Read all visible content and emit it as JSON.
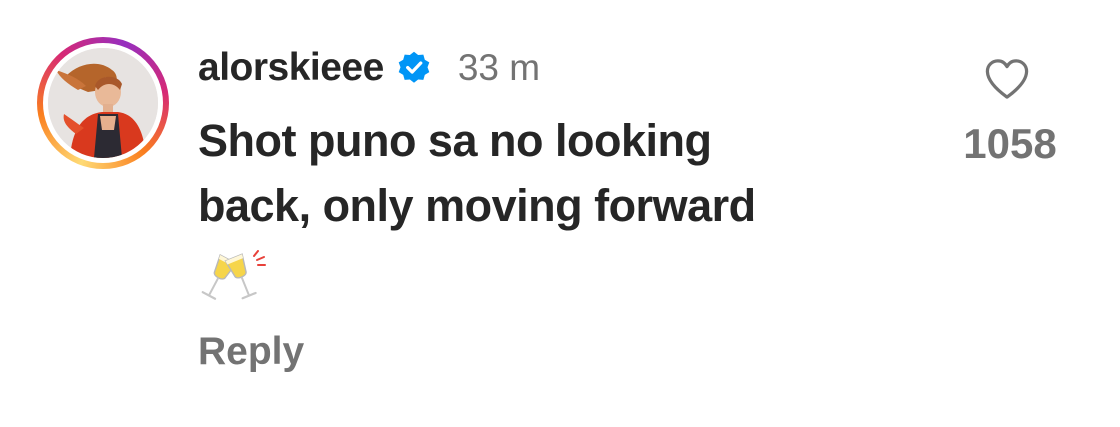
{
  "comment": {
    "username": "alorskieee",
    "verified": true,
    "time_ago": "33 m",
    "text_line1": "Shot puno sa no looking",
    "text_line2": "back, only moving forward",
    "emoji": "clinking-glasses",
    "reply_label": "Reply"
  },
  "likes": {
    "count": "1058",
    "icon": "heart-outline-icon"
  },
  "colors": {
    "primary_text": "#262626",
    "secondary_text": "#737373",
    "verified_blue": "#0095f6"
  }
}
